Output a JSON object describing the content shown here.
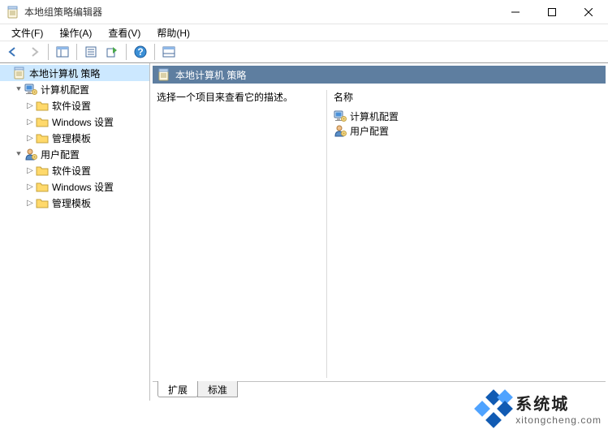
{
  "window": {
    "title": "本地组策略编辑器"
  },
  "menus": {
    "file": "文件(F)",
    "action": "操作(A)",
    "view": "查看(V)",
    "help": "帮助(H)"
  },
  "tree": {
    "root": "本地计算机 策略",
    "computer_config": "计算机配置",
    "user_config": "用户配置",
    "software_settings": "软件设置",
    "windows_settings": "Windows 设置",
    "admin_templates": "管理模板"
  },
  "detail": {
    "header": "本地计算机 策略",
    "description": "选择一个项目来查看它的描述。",
    "column_name": "名称",
    "items": {
      "computer_config": "计算机配置",
      "user_config": "用户配置"
    }
  },
  "tabs": {
    "extended": "扩展",
    "standard": "标准"
  },
  "watermark": {
    "name": "系统城",
    "url": "xitongcheng.com"
  }
}
